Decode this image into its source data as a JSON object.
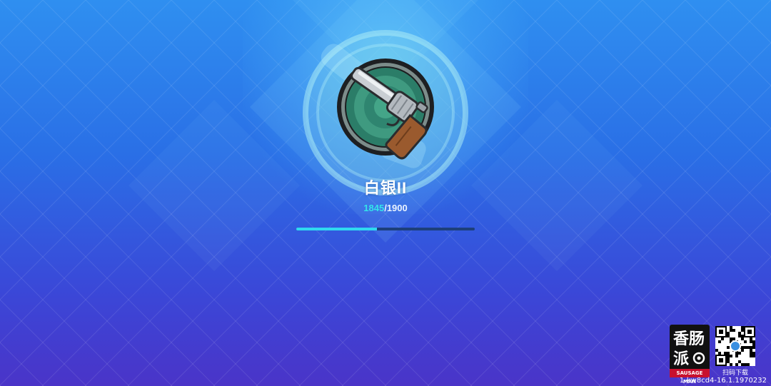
{
  "rank": {
    "title": "白银II",
    "icon": "revolver-icon"
  },
  "progress": {
    "current": "1845",
    "separator": "/",
    "max": "1900",
    "bar_fraction": 0.45
  },
  "colors": {
    "progress_current": "#33e3ea",
    "progress_fill": "#2fd9f0",
    "progress_track": "#1d3f7a",
    "badge_inner": "#3f9a80"
  },
  "watermark": {
    "logo_tag": "SAUSAGE MAN",
    "logo_icon": "sausage-man-logo",
    "qr_caption": "扫码下载",
    "build": "1-kw8cd4-16.1.1970232"
  }
}
